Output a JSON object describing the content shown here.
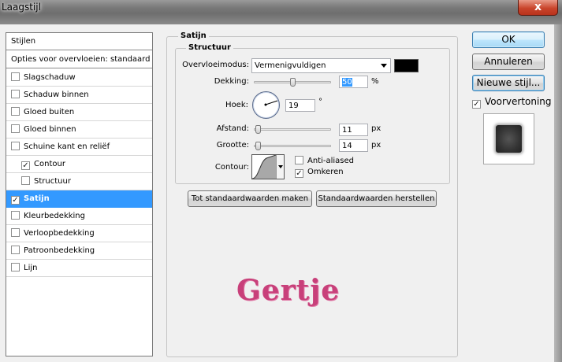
{
  "window": {
    "title": "Laagstijl",
    "close_label": "x"
  },
  "styles_panel": {
    "header": "Stijlen",
    "blend_options": "Opties voor overvloeien: standaard",
    "items": [
      {
        "label": "Slagschaduw",
        "checked": false,
        "indent": false,
        "selected": false
      },
      {
        "label": "Schaduw binnen",
        "checked": false,
        "indent": false,
        "selected": false
      },
      {
        "label": "Gloed buiten",
        "checked": false,
        "indent": false,
        "selected": false
      },
      {
        "label": "Gloed binnen",
        "checked": false,
        "indent": false,
        "selected": false
      },
      {
        "label": "Schuine kant en reliëf",
        "checked": false,
        "indent": false,
        "selected": false
      },
      {
        "label": "Contour",
        "checked": true,
        "indent": true,
        "selected": false
      },
      {
        "label": "Structuur",
        "checked": false,
        "indent": true,
        "selected": false
      },
      {
        "label": "Satijn",
        "checked": true,
        "indent": false,
        "selected": true
      },
      {
        "label": "Kleurbedekking",
        "checked": false,
        "indent": false,
        "selected": false
      },
      {
        "label": "Verloopbedekking",
        "checked": false,
        "indent": false,
        "selected": false
      },
      {
        "label": "Patroonbedekking",
        "checked": false,
        "indent": false,
        "selected": false
      },
      {
        "label": "Lijn",
        "checked": false,
        "indent": false,
        "selected": false
      }
    ]
  },
  "satin": {
    "group_title": "Satijn",
    "structure_title": "Structuur",
    "blend_mode_label": "Overvloeimodus:",
    "blend_mode_value": "Vermenigvuldigen",
    "blend_color": "#000000",
    "opacity_label": "Dekking:",
    "opacity_value": "50",
    "opacity_unit": "%",
    "opacity_level": 0.5,
    "angle_label": "Hoek:",
    "angle_value": "19",
    "angle_unit": "°",
    "distance_label": "Afstand:",
    "distance_value": "11",
    "distance_unit": "px",
    "distance_level": 0.05,
    "size_label": "Grootte:",
    "size_value": "14",
    "size_unit": "px",
    "size_level": 0.05,
    "contour_label": "Contour:",
    "anti_aliased_label": "Anti-aliased",
    "anti_aliased_checked": false,
    "invert_label": "Omkeren",
    "invert_checked": true,
    "make_default_button": "Tot standaardwaarden maken",
    "reset_default_button": "Standaardwaarden herstellen"
  },
  "right_panel": {
    "ok_button": "OK",
    "cancel_button": "Annuleren",
    "new_style_button": "Nieuwe stijl...",
    "preview_label": "Voorvertoning",
    "preview_checked": true
  },
  "preview_text": "Gertje",
  "colors": {
    "selection": "#3399ff",
    "preview_text": "#c8407a"
  }
}
